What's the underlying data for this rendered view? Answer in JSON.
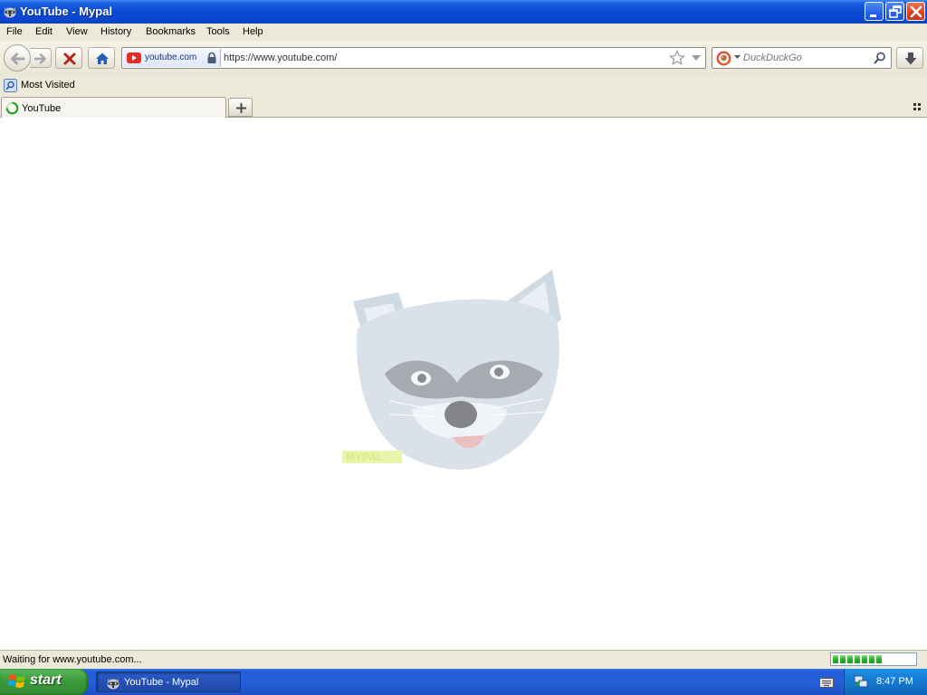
{
  "window": {
    "title": "YouTube - Mypal"
  },
  "menu": [
    "File",
    "Edit",
    "View",
    "History",
    "Bookmarks",
    "Tools",
    "Help"
  ],
  "navigation": {
    "identity_label": "youtube.com",
    "url": "https://www.youtube.com/",
    "search_engine": "DuckDuckGo",
    "search_placeholder": "DuckDuckGo"
  },
  "bookmarks": [
    {
      "label": "Most Visited"
    }
  ],
  "tabs": [
    {
      "label": "YouTube",
      "loading": true
    }
  ],
  "content": {
    "logo_text": "MYPAL"
  },
  "status": {
    "text": "Waiting for www.youtube.com...",
    "progress_fraction": 0.6
  },
  "taskbar": {
    "start_label": "start",
    "task_label": "YouTube - Mypal",
    "clock": "8:47 PM"
  },
  "colors": {
    "titlebar": "#0a4ad3",
    "taskbar": "#245edb",
    "start": "#3c9b3c",
    "progress": "#25b125",
    "chrome": "#ece9d8"
  }
}
